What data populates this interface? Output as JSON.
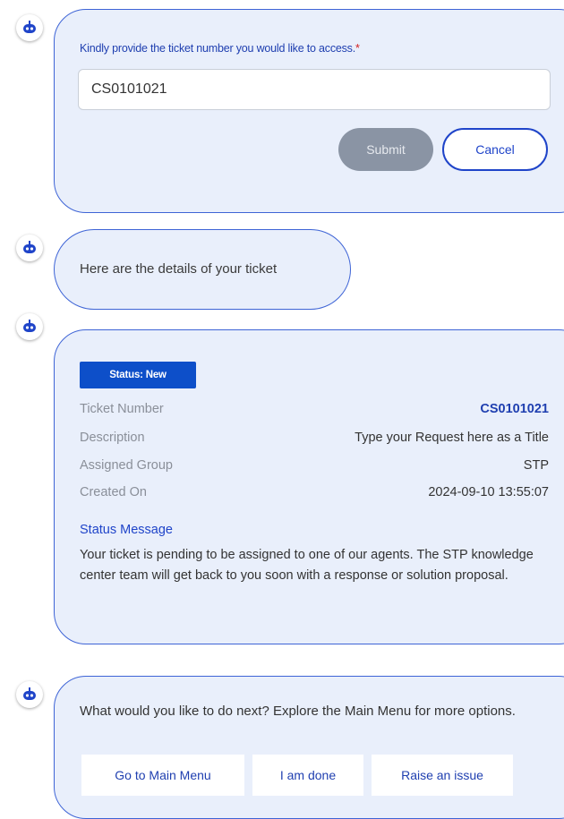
{
  "form": {
    "prompt": "Kindly provide the ticket number you would like to access.",
    "required_mark": "*",
    "ticket_input_value": "CS0101021",
    "submit_label": "Submit",
    "cancel_label": "Cancel"
  },
  "intro_message": "Here are the details of your ticket",
  "ticket": {
    "status_badge": "Status: New",
    "rows": [
      {
        "label": "Ticket Number",
        "value": "CS0101021"
      },
      {
        "label": "Description",
        "value": "Type your Request here as a Title"
      },
      {
        "label": "Assigned Group",
        "value": "STP"
      },
      {
        "label": "Created On",
        "value": "2024-09-10 13:55:07"
      }
    ],
    "status_message_title": "Status Message",
    "status_message_body": "Your ticket is pending to be assigned to one of our agents. The STP knowledge center team will get back to you soon with a response or solution proposal."
  },
  "next": {
    "text": "What would you like to do next? Explore the Main Menu for more options.",
    "buttons": [
      "Go to Main Menu",
      "I am done",
      "Raise an issue"
    ]
  },
  "colors": {
    "accent": "#1f44c9",
    "bubble_bg": "#e9effb",
    "badge": "#0d4fc9"
  }
}
